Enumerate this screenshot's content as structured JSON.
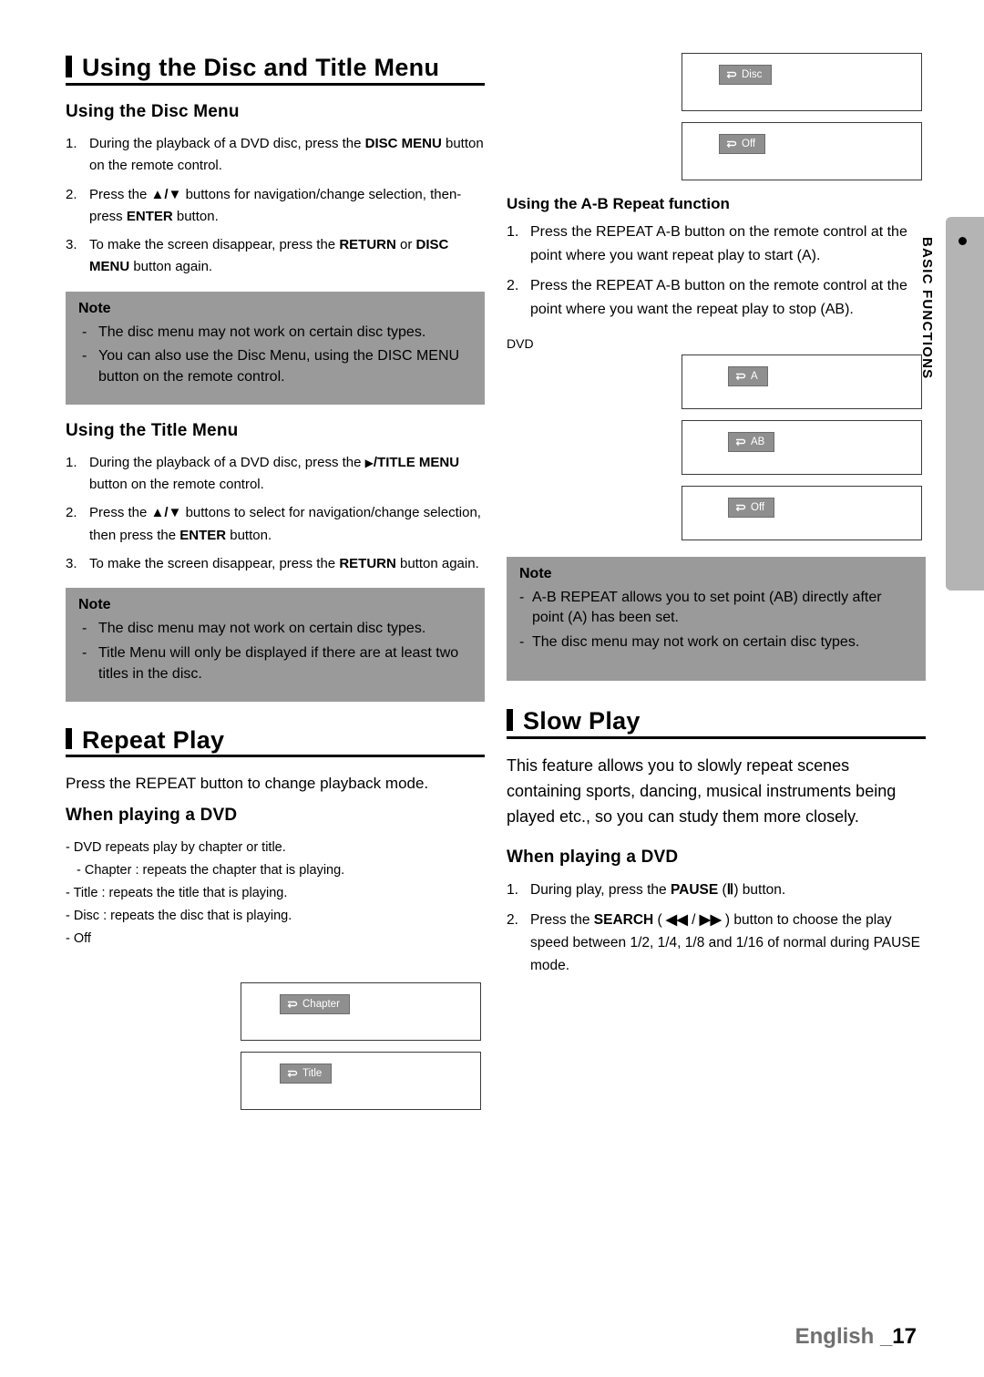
{
  "left": {
    "title": "Using the Disc and Title Menu",
    "disc_menu": {
      "heading": "Using the Disc Menu",
      "steps": [
        "During the playback of a DVD disc, press the DISC MENU button on the remote control.",
        "Press the ▲/▼ buttons for navigation/change selection, then-press ENTER button.",
        "To make the screen disappear, press the RETURN or DISC MENU button again."
      ],
      "note": {
        "title": "Note",
        "items": [
          "The disc menu may not work on certain disc types.",
          "You can also use the Disc Menu, using the DISC MENU button on the remote control."
        ]
      }
    },
    "title_menu": {
      "heading": "Using the Title Menu",
      "steps": [
        "During the playback of a DVD disc, press the ▶/TITLE MENU button on the remote control.",
        "Press the ▲/▼ buttons to select for navigation/change selection, then press the ENTER button.",
        "To make the screen disappear, press the RETURN button again."
      ],
      "note": {
        "title": "Note",
        "items": [
          "The disc menu may not work on certain disc types.",
          "Title Menu will only be displayed if there are at least two titles in the disc."
        ]
      }
    },
    "repeat_play": {
      "title": "Repeat Play",
      "intro": "Press the REPEAT button to change playback mode.",
      "subheading": "When playing a DVD",
      "items": [
        "- DVD repeats play by chapter or title.",
        "- Chapter : repeats the chapter that is playing.",
        "- Title : repeats the title that is playing.",
        "- Disc : repeats the disc that is playing.",
        "- Off"
      ],
      "osd": [
        {
          "label": "Chapter"
        },
        {
          "label": "Title"
        }
      ]
    }
  },
  "right": {
    "osd_top": [
      {
        "label": "Disc"
      },
      {
        "label": "Off"
      }
    ],
    "ab_repeat": {
      "heading": "Using the A-B Repeat function",
      "steps": [
        "Press the REPEAT A-B button on the remote control at the point where you want repeat play to start (A).",
        "Press the REPEAT A-B button on the remote control at the point where you want the repeat play to stop (AB)."
      ],
      "osd_label": "DVD",
      "osd": [
        {
          "label": "A"
        },
        {
          "label": "AB"
        },
        {
          "label": "Off"
        }
      ],
      "note": {
        "title": "Note",
        "items": [
          "A-B REPEAT allows you to set point (AB) directly after point (A) has been set.",
          "The disc menu may not work on certain disc types."
        ]
      }
    },
    "slow_play": {
      "title": "Slow Play",
      "intro": "This feature allows you to slowly repeat scenes containing sports, dancing, musical instruments being played etc., so you can study them more closely.",
      "subheading": "When playing a DVD",
      "steps": [
        "During play, press the PAUSE ( Ⅱ ) button.",
        "Press the SEARCH ( ◀◀ / ▶▶ ) button to choose the play speed between 1/2, 1/4, 1/8 and 1/16 of normal during PAUSE mode."
      ]
    }
  },
  "sidetab": {
    "label": "BASIC FUNCTIONS"
  },
  "footer": {
    "language": "English _",
    "page": "17"
  }
}
